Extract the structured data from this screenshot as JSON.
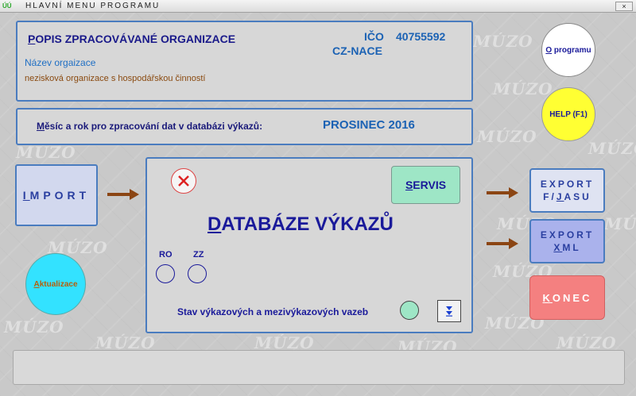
{
  "window": {
    "title": "HLAVNÍ MENU PROGRAMU",
    "app_icon": "ÚÚ",
    "close_label": "×"
  },
  "watermark": "MÚZO",
  "organization": {
    "heading_hotkey": "P",
    "heading_rest": "OPIS ZPRACOVÁVANÉ ORGANIZACE",
    "ico_label": "IČO",
    "ico_value": "40755592",
    "nace_label": "CZ-NACE",
    "name_label": "Název orgaizace",
    "name_value": "nezisková organizace s hospodářskou činností"
  },
  "period": {
    "label_hotkey": "M",
    "label_rest": "ěsíc a rok pro zpracování dat v databázi  výkazů:",
    "value": "PROSINEC 2016"
  },
  "buttons": {
    "import_hotkey": "I",
    "import_rest": "MPORT",
    "aktualizace_hotkey": "A",
    "aktualizace_rest": "ktualizace",
    "o_programu_hotkey": "O",
    "o_programu_rest": " programu",
    "help": "HELP (F1)",
    "servis_hotkey": "S",
    "servis_rest": "ERVIS",
    "export_fjasu_line1": "EXPORT",
    "export_fjasu_line2_a": "F/",
    "export_fjasu_line2_hotkey": "J",
    "export_fjasu_line2_b": "ASU",
    "export_xml_line1": "EXPORT",
    "export_xml_line2_hotkey": "X",
    "export_xml_line2_rest": "ML",
    "konec_hotkey": "K",
    "konec_rest": "ONEC"
  },
  "database": {
    "title_hotkey": "D",
    "title_rest": "ATABÁZE VÝKAZŮ",
    "ro_label": "RO",
    "zz_label": "ZZ",
    "stav_label": "Stav výkazových a mezivýkazových vazeb"
  },
  "colors": {
    "panel_border": "#4a7cbf",
    "arrow": "#8b4513",
    "servis_bg": "#9ee6c6",
    "help_bg": "#ffff33",
    "aktualizace_bg": "#33e2ff",
    "konec_bg": "#f48080",
    "export_xml_bg": "#aab2ec"
  },
  "icons": {
    "delete": "delete-x-icon",
    "down": "arrow-down-icon",
    "arrow": "arrow-right-icon"
  }
}
